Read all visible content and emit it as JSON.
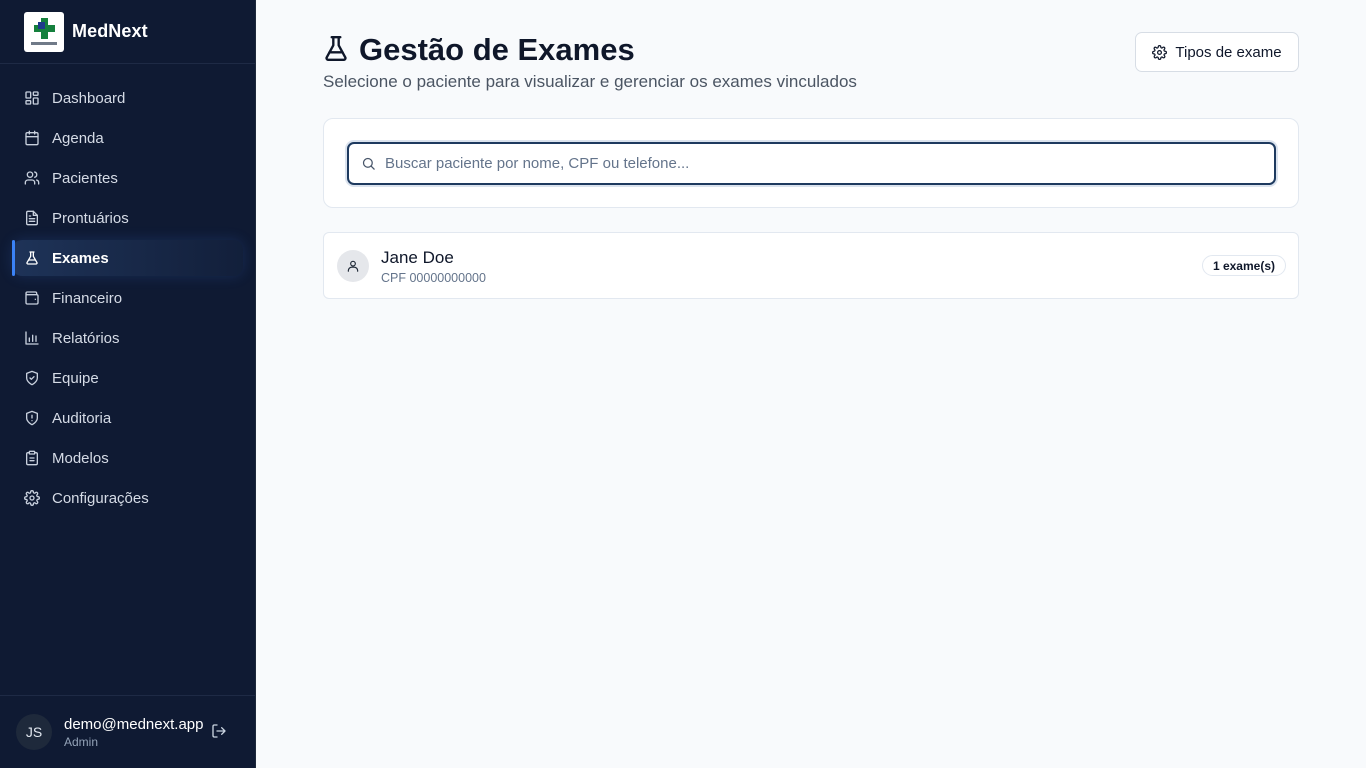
{
  "brand": {
    "name": "MedNext"
  },
  "sidebar": {
    "items": [
      {
        "label": "Dashboard",
        "icon": "dashboard-icon"
      },
      {
        "label": "Agenda",
        "icon": "calendar-icon"
      },
      {
        "label": "Pacientes",
        "icon": "users-icon"
      },
      {
        "label": "Prontuários",
        "icon": "file-text-icon"
      },
      {
        "label": "Exames",
        "icon": "flask-icon",
        "active": true
      },
      {
        "label": "Financeiro",
        "icon": "wallet-icon"
      },
      {
        "label": "Relatórios",
        "icon": "bar-chart-icon"
      },
      {
        "label": "Equipe",
        "icon": "shield-check-icon"
      },
      {
        "label": "Auditoria",
        "icon": "shield-alert-icon"
      },
      {
        "label": "Modelos",
        "icon": "clipboard-icon"
      },
      {
        "label": "Configurações",
        "icon": "gear-icon"
      }
    ]
  },
  "user": {
    "initials": "JS",
    "email": "demo@mednext.app",
    "role": "Admin"
  },
  "header": {
    "title": "Gestão de Exames",
    "subtitle": "Selecione o paciente para visualizar e gerenciar os exames vinculados",
    "tipos_label": "Tipos de exame"
  },
  "search": {
    "placeholder": "Buscar paciente por nome, CPF ou telefone...",
    "value": ""
  },
  "patients": [
    {
      "name": "Jane Doe",
      "cpf": "CPF 00000000000",
      "badge": "1 exame(s)"
    }
  ],
  "colors": {
    "sidebar_bg": "#0f1a33",
    "accent": "#3b82f6",
    "page_bg": "#f8fafc"
  }
}
